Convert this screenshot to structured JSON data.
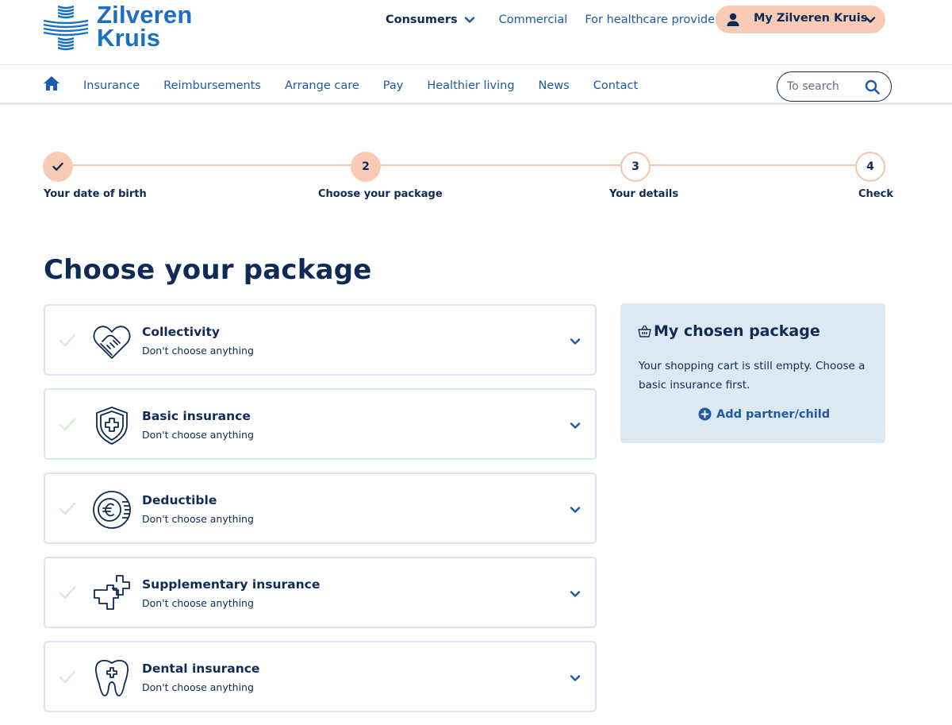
{
  "brand": {
    "name_line1": "Zilveren",
    "name_line2": "Kruis",
    "color": "#1b6fc2"
  },
  "top_nav": {
    "consumers": "Consumers",
    "commercial": "Commercial",
    "healthcare": "For healthcare providers",
    "my_account": "My Zilveren Kruis"
  },
  "main_nav": {
    "items": [
      "Insurance",
      "Reimbursements",
      "Arrange care",
      "Pay",
      "Healthier living",
      "News",
      "Contact"
    ],
    "search_placeholder": "To search"
  },
  "stepper": {
    "steps": [
      {
        "number": "",
        "label": "Your date of birth",
        "state": "done"
      },
      {
        "number": "2",
        "label": "Choose your package",
        "state": "current"
      },
      {
        "number": "3",
        "label": "Your details",
        "state": "todo"
      },
      {
        "number": "4",
        "label": "Check",
        "state": "todo"
      }
    ],
    "accent": "#f8cbb6"
  },
  "page_title": "Choose your package",
  "packages": [
    {
      "title": "Collectivity",
      "status": "Don't choose anything",
      "icon": "handshake-heart-icon"
    },
    {
      "title": "Basic insurance",
      "status": "Don't choose anything",
      "icon": "shield-cross-icon"
    },
    {
      "title": "Deductible",
      "status": "Don't choose anything",
      "icon": "euro-coin-icon"
    },
    {
      "title": "Supplementary insurance",
      "status": "Don't choose anything",
      "icon": "double-cross-icon"
    },
    {
      "title": "Dental insurance",
      "status": "Don't choose anything",
      "icon": "tooth-cross-icon"
    }
  ],
  "cart": {
    "title": "My chosen package",
    "text": "Your shopping cart is still empty. Choose a basic insurance first.",
    "add_label": "Add partner/child",
    "background": "#dde9f2"
  }
}
